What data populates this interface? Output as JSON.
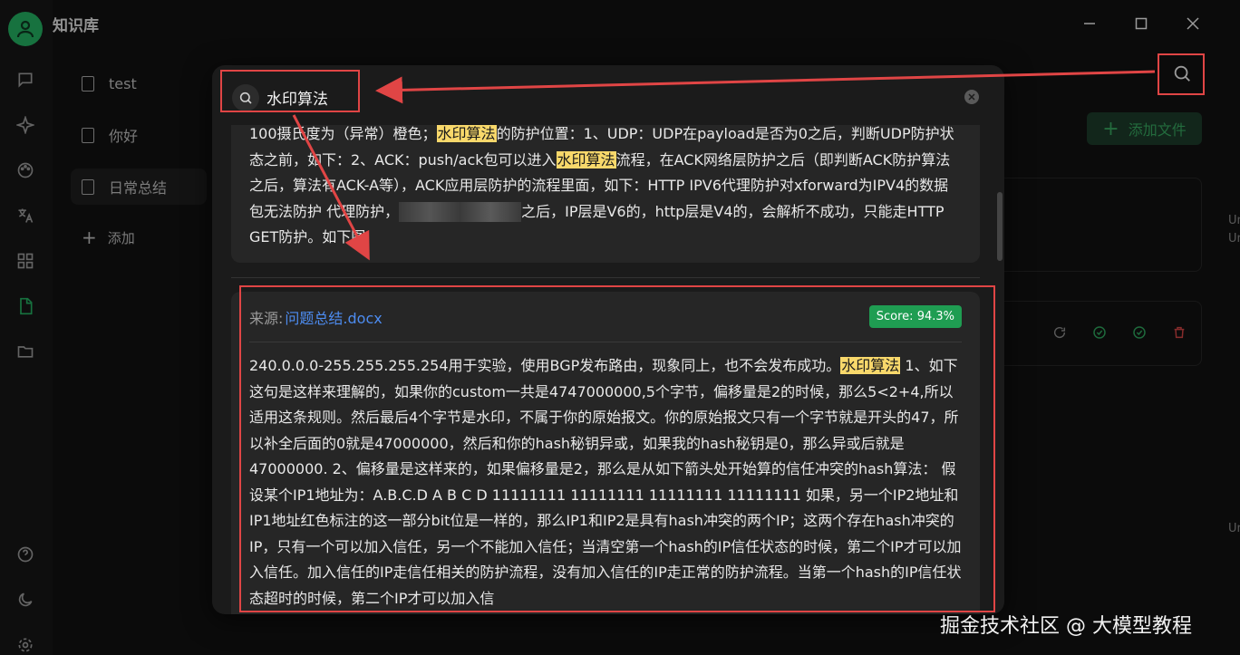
{
  "app": {
    "title": "知识库"
  },
  "sidebar_items": [
    {
      "label": "test"
    },
    {
      "label": "你好"
    },
    {
      "label": "日常总结"
    }
  ],
  "add_kb_label": "添加",
  "toolbar": {
    "add_file_label": "添加文件"
  },
  "right_edge_texts": [
    "Un",
    "Un",
    "Un"
  ],
  "search": {
    "query": "水印算法",
    "results": [
      {
        "segments": [
          {
            "text": "100摄氏度为（异常）橙色；",
            "hl": false
          },
          {
            "text": "水印算法",
            "hl": true
          },
          {
            "text": "的防护位置：1、UDP：UDP在payload是否为0之后，判断UDP防护状态之前，如下：2、ACK：push/ack包可以进入",
            "hl": false
          },
          {
            "text": "水印算法",
            "hl": true
          },
          {
            "text": "流程，在ACK网络层防护之后（即判断ACK防护算法之后，算法有ACK-A等），ACK应用层防护的流程里面，如下：HTTP IPV6代理防护对xforward为IPV4的数据包无法防护 代理防护，",
            "hl": false
          },
          {
            "text": "",
            "blur": true
          },
          {
            "text": "之后，IP层是V6的，http层是V4的，会解析不成功，只能走HTTP GET防护。如下图:",
            "hl": false
          }
        ]
      },
      {
        "source_label": "来源:",
        "source_file": "问题总结.docx",
        "score": "Score: 94.3%",
        "segments": [
          {
            "text": "240.0.0.0-255.255.255.254用于实验，使用BGP发布路由，现象同上，也不会发布成功。",
            "hl": false
          },
          {
            "text": "水印算法",
            "hl": true
          },
          {
            "text": " 1、如下这句是这样来理解的，如果你的custom一共是4747000000,5个字节，偏移量是2的时候，那么5<2+4,所以适用这条规则。然后最后4个字节是水印，不属于你的原始报文。你的原始报文只有一个字节就是开头的47，所以补全后面的0就是47000000，然后和你的hash秘钥异或，如果我的hash秘钥是0，那么异或后就是47000000. 2、偏移量是这样来的，如果偏移量是2，那么是从如下箭头处开始算的信任冲突的hash算法：  假设某个IP1地址为：A.B.C.D A B C D 11111111 11111111 11111111 11111111 如果，另一个IP2地址和IP1地址红色标注的这一部分bit位是一样的，那么IP1和IP2是具有hash冲突的两个IP；这两个存在hash冲突的IP，只有一个可以加入信任，另一个不能加入信任；当清空第一个hash的IP信任状态的时候，第二个IP才可以加入信任。加入信任的IP走信任相关的防护流程，没有加入信任的IP走正常的防护流程。当第一个hash的IP信任状态超时的时候，第二个IP才可以加入信",
            "hl": false
          }
        ]
      }
    ]
  },
  "watermark": "掘金技术社区 @ 大模型教程",
  "colors": {
    "accent_green": "#24b062",
    "highlight": "#f8d86b",
    "annotation_red": "#e04545",
    "link_blue": "#4d8cf0"
  },
  "icons": [
    "user-icon",
    "chat-icon",
    "sparkle-icon",
    "palette-icon",
    "translate-icon",
    "grid-icon",
    "file-icon",
    "folder-icon",
    "help-icon",
    "moon-icon",
    "settings-icon",
    "search-icon",
    "clear-icon",
    "minimize-icon",
    "maximize-icon",
    "close-icon",
    "refresh-icon",
    "check-circle-icon",
    "trash-icon"
  ]
}
